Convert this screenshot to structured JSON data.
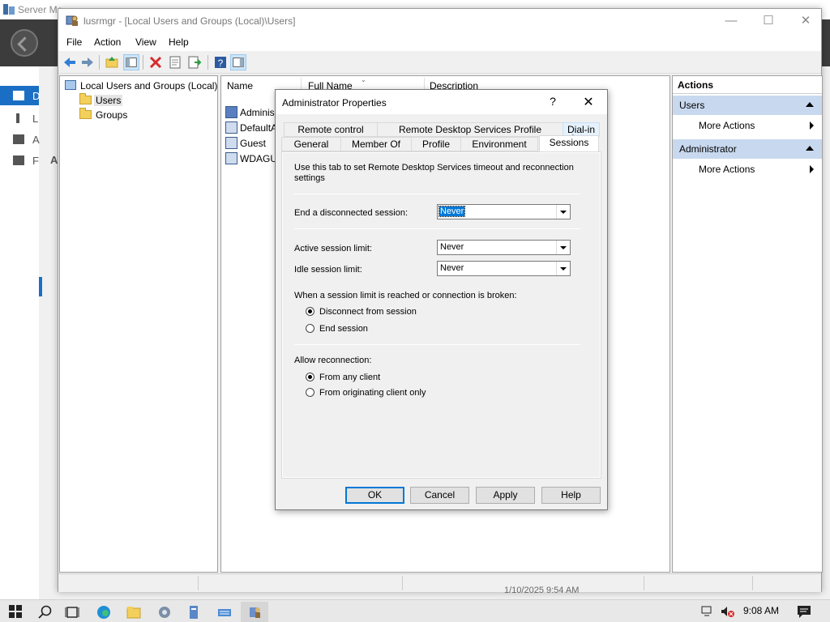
{
  "server_manager": {
    "title": "Server Ma",
    "sidebar_labels": [
      "D",
      "L",
      "A",
      "F"
    ],
    "section_letter": "A"
  },
  "window": {
    "title": "lusrmgr - [Local Users and Groups (Local)\\Users]",
    "minimize": "—",
    "maximize": "☐",
    "close": "✕"
  },
  "menu": [
    "File",
    "Action",
    "View",
    "Help"
  ],
  "tree": {
    "root": "Local Users and Groups (Local)",
    "children": [
      "Users",
      "Groups"
    ],
    "selected": "Users"
  },
  "list": {
    "columns": [
      "Name",
      "Full Name",
      "Description"
    ],
    "rows": [
      "Adminis",
      "DefaultA",
      "Guest",
      "WDAGUt"
    ]
  },
  "actions": {
    "header": "Actions",
    "sections": [
      {
        "title": "Users",
        "items": [
          "More Actions"
        ]
      },
      {
        "title": "Administrator",
        "items": [
          "More Actions"
        ]
      }
    ]
  },
  "status": {
    "text": "1/10/2025 9:54 AM"
  },
  "dialog": {
    "title": "Administrator Properties",
    "help": "?",
    "close": "✕",
    "tabs_row1": [
      "Remote control",
      "Remote Desktop Services Profile",
      "Dial-in"
    ],
    "tabs_row2": [
      "General",
      "Member Of",
      "Profile",
      "Environment",
      "Sessions"
    ],
    "active_tab": "Sessions",
    "hint": "Use this tab to set Remote Desktop Services timeout and reconnection settings",
    "end_disconnected_label": "End a disconnected session:",
    "end_disconnected_value": "Never",
    "active_limit_label": "Active session limit:",
    "active_limit_value": "Never",
    "idle_limit_label": "Idle session limit:",
    "idle_limit_value": "Never",
    "limit_reached_label": "When a session limit is reached or connection is broken:",
    "limit_options": [
      "Disconnect from session",
      "End session"
    ],
    "limit_selected": 0,
    "reconnect_label": "Allow reconnection:",
    "reconnect_options": [
      "From any client",
      "From originating client only"
    ],
    "reconnect_selected": 0,
    "buttons": {
      "ok": "OK",
      "cancel": "Cancel",
      "apply": "Apply",
      "help": "Help"
    }
  },
  "taskbar": {
    "time": "9:08 AM",
    "icons": [
      "search-icon",
      "task-view-icon",
      "edge-icon",
      "file-explorer-icon",
      "server-manager-icon",
      "lusrmgr-icon",
      "keyboard-icon",
      "computer-management-icon"
    ]
  },
  "colors": {
    "accent": "#0078d7",
    "section_header": "#c8d9ef",
    "sm_header": "#3c3c3c"
  }
}
